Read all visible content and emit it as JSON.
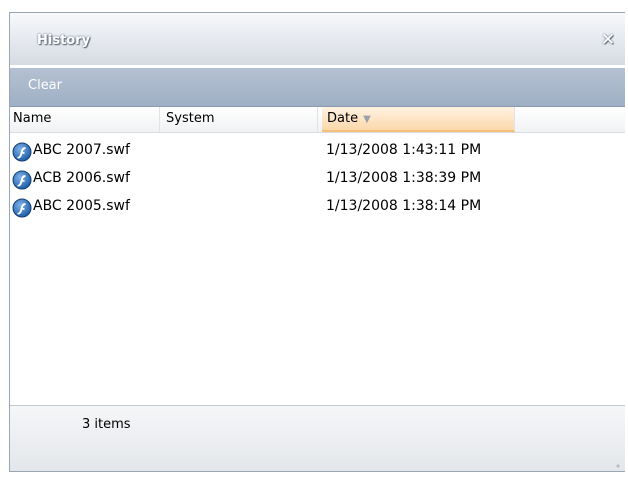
{
  "panel": {
    "title": "History",
    "close_icon": "close-icon"
  },
  "toolbar": {
    "clear_label": "Clear"
  },
  "columns": {
    "name": "Name",
    "system": "System",
    "date": "Date"
  },
  "sort": {
    "column": "Date",
    "icon": "sort-descending-icon"
  },
  "rows": [
    {
      "name": "ABC 2007.swf",
      "system": "",
      "date": "1/13/2008 1:43:11 PM",
      "icon": "flash-file-icon"
    },
    {
      "name": "ACB 2006.swf",
      "system": "",
      "date": "1/13/2008 1:38:39 PM",
      "icon": "flash-file-icon"
    },
    {
      "name": "ABC 2005.swf",
      "system": "",
      "date": "1/13/2008 1:38:14 PM",
      "icon": "flash-file-icon"
    }
  ],
  "status": {
    "count_label": "3 items"
  },
  "colors": {
    "toolbar": "#a8b7ca",
    "sorted_header": "#fbd8aa",
    "flash_icon": "#1f5fa8"
  }
}
